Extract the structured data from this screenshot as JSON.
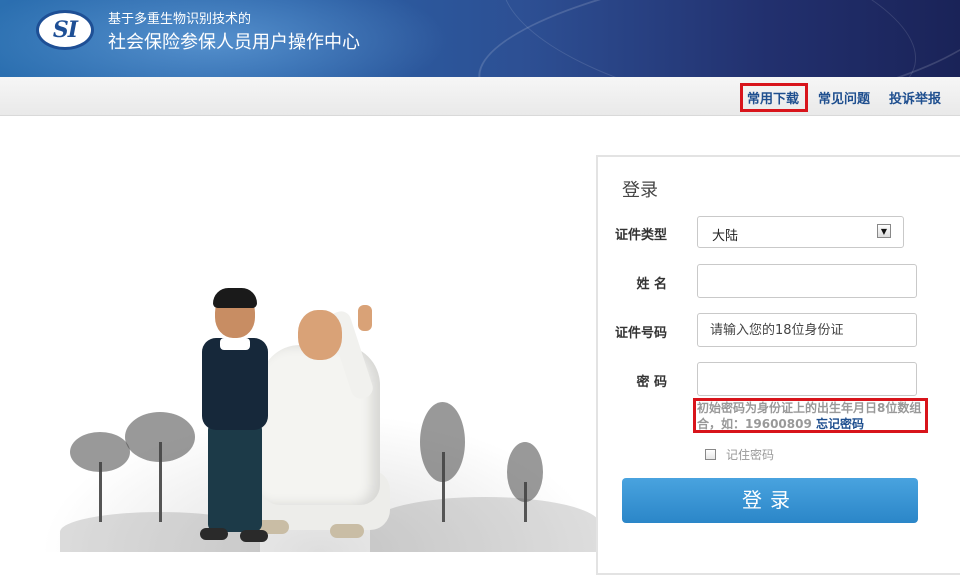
{
  "header": {
    "logo_text": "SI",
    "subtitle": "基于多重生物识别技术的",
    "title": "社会保险参保人员用户操作中心"
  },
  "nav": {
    "links": [
      "常用下载",
      "常见问题",
      "投诉举报"
    ]
  },
  "login": {
    "heading": "登录",
    "id_type_label": "证件类型",
    "id_type_value": "大陆",
    "name_label": "姓 名",
    "name_value": "",
    "id_number_label": "证件号码",
    "id_number_placeholder": "请输入您的18位身份证",
    "password_label": "密 码",
    "password_value": "",
    "hint_text": "初始密码为身份证上的出生年月日8位数组合，如：",
    "hint_example": "19600809",
    "forgot_password": "忘记密码",
    "remember_label": "记住密码",
    "submit_label": "登录"
  },
  "colors": {
    "header_blue": "#2a61a6",
    "link_blue": "#1f4f8f",
    "highlight_red": "#d8141b",
    "button_blue": "#2b86c8"
  }
}
